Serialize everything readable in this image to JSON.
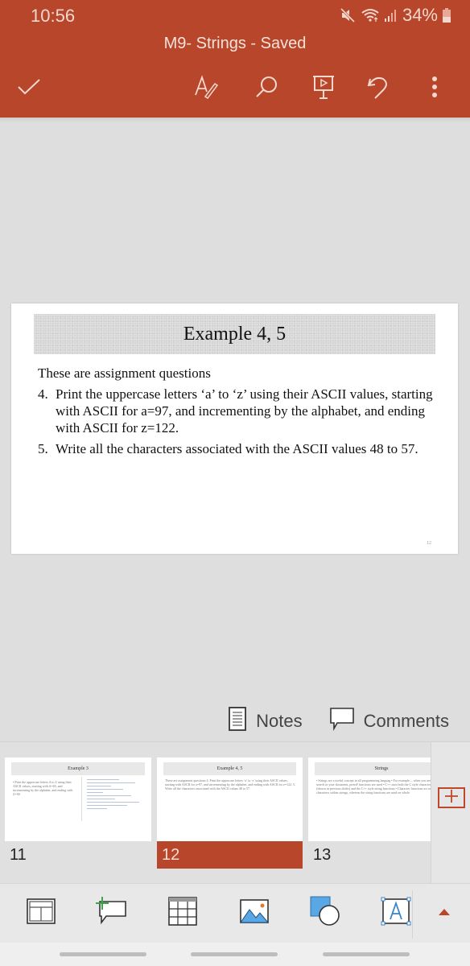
{
  "status_bar": {
    "time": "10:56",
    "battery": "34%",
    "icons": [
      "mute-icon",
      "wifi-icon",
      "signal-icon",
      "battery-icon"
    ]
  },
  "header": {
    "document_title": "M9- Strings - Saved",
    "toolbar": [
      {
        "name": "done",
        "icon": "checkmark-icon"
      },
      {
        "name": "draw",
        "icon": "draw-pen-icon"
      },
      {
        "name": "search",
        "icon": "search-icon"
      },
      {
        "name": "present",
        "icon": "present-icon"
      },
      {
        "name": "undo",
        "icon": "undo-icon"
      },
      {
        "name": "more",
        "icon": "more-vertical-icon"
      }
    ]
  },
  "slide": {
    "title": "Example 4, 5",
    "intro": "These are assignment questions",
    "items": [
      {
        "num": "4.",
        "text": "Print the uppercase letters ‘a’ to ‘z’ using their ASCII values, starting with ASCII for a=97, and incrementing by the alphabet, and ending with ASCII for z=122."
      },
      {
        "num": "5.",
        "text": "Write all the characters associated with the ASCII values 48 to 57."
      }
    ],
    "page_number": "12"
  },
  "notes_comments": {
    "notes_label": "Notes",
    "comments_label": "Comments"
  },
  "thumbnails": [
    {
      "number": "11",
      "title": "Example 3",
      "text": "• Print the uppercase letters A to Z using their ASCII values, starting with A=65, and incrementing by the alphabet, and ending with Z=90",
      "selected": false
    },
    {
      "number": "12",
      "title": "Example 4, 5",
      "text": "These are assignment questions 4. Print the uppercase letters ‘a’ to ‘z’ using their ASCII values, starting with ASCII for a=97, and incrementing by the alphabet, and ending with ASCII for z=122. 5. Write all the characters associated with the ASCII values 48 to 57.",
      "selected": true
    },
    {
      "number": "13",
      "title": "Strings",
      "text": "• Strings are a useful concept in all programming languag • For example, – when you are doing a word search in your document, pressF functions are used • C++ uses both the C style character functions (shown in previous slides) and the C++ style string functions • Character functions act on individual characters within strings, whereas the string functions are used on whole",
      "selected": false
    }
  ],
  "bottom_toolbar": [
    {
      "name": "layout",
      "icon": "layout-icon"
    },
    {
      "name": "new-comment",
      "icon": "add-comment-icon"
    },
    {
      "name": "table",
      "icon": "table-icon"
    },
    {
      "name": "picture",
      "icon": "picture-icon"
    },
    {
      "name": "shapes",
      "icon": "shapes-icon"
    },
    {
      "name": "text-box",
      "icon": "text-box-icon"
    },
    {
      "name": "expand",
      "icon": "caret-up-icon"
    }
  ],
  "colors": {
    "accent": "#b7462a",
    "canvas": "#dedede",
    "shape_blue": "#5aa7e6",
    "comment_plus_green": "#3fa34d"
  }
}
